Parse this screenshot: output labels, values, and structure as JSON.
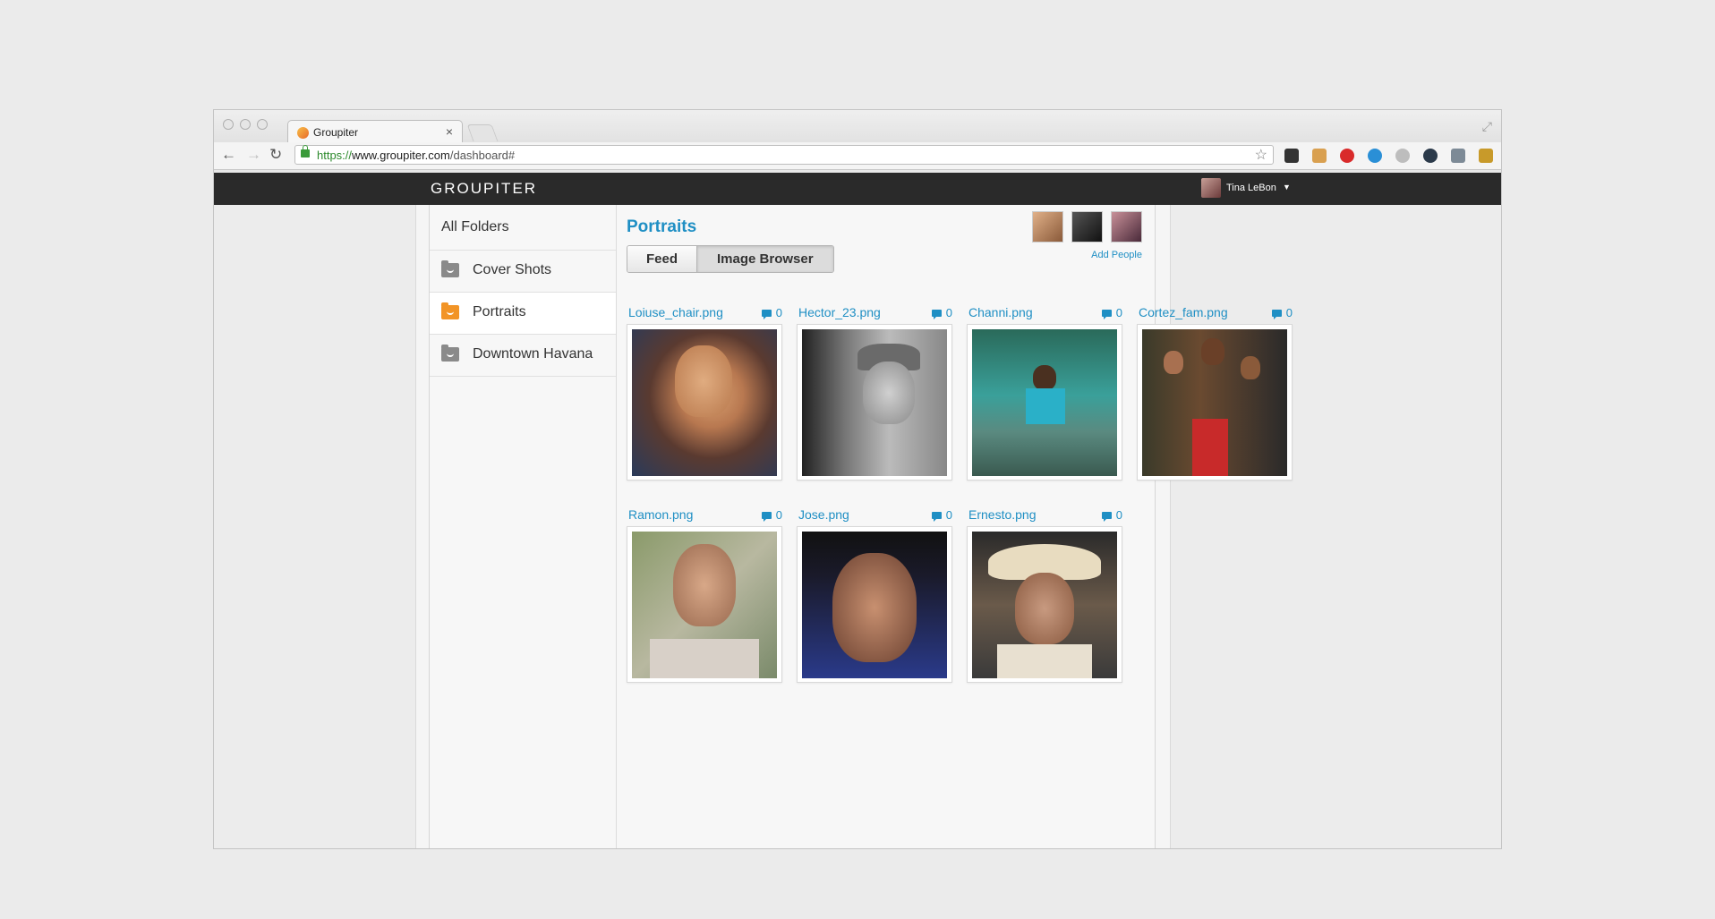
{
  "browser": {
    "tab_title": "Groupiter",
    "tab_close": "×",
    "url_proto": "https://",
    "url_host": "www.groupiter.com",
    "url_path": "/dashboard#"
  },
  "app": {
    "logo": "GROUPITER",
    "user_name": "Tina LeBon"
  },
  "sidebar": {
    "all_folders": "All Folders",
    "items": [
      {
        "label": "Cover Shots",
        "active": false
      },
      {
        "label": "Portraits",
        "active": true
      },
      {
        "label": "Downtown Havana",
        "active": false
      }
    ]
  },
  "main": {
    "title": "Portraits",
    "tabs": [
      "Feed",
      "Image Browser"
    ],
    "active_tab": "Image Browser",
    "add_people": "Add People",
    "images": [
      {
        "name": "Loiuse_chair.png",
        "comments": "0"
      },
      {
        "name": "Hector_23.png",
        "comments": "0"
      },
      {
        "name": "Channi.png",
        "comments": "0"
      },
      {
        "name": "Cortez_fam.png",
        "comments": "0"
      },
      {
        "name": "Ramon.png",
        "comments": "0"
      },
      {
        "name": "Jose.png",
        "comments": "0"
      },
      {
        "name": "Ernesto.png",
        "comments": "0"
      }
    ]
  },
  "colors": {
    "accent": "#1f8fc4",
    "folder_active": "#f29426",
    "appbar": "#2a2a2a"
  }
}
